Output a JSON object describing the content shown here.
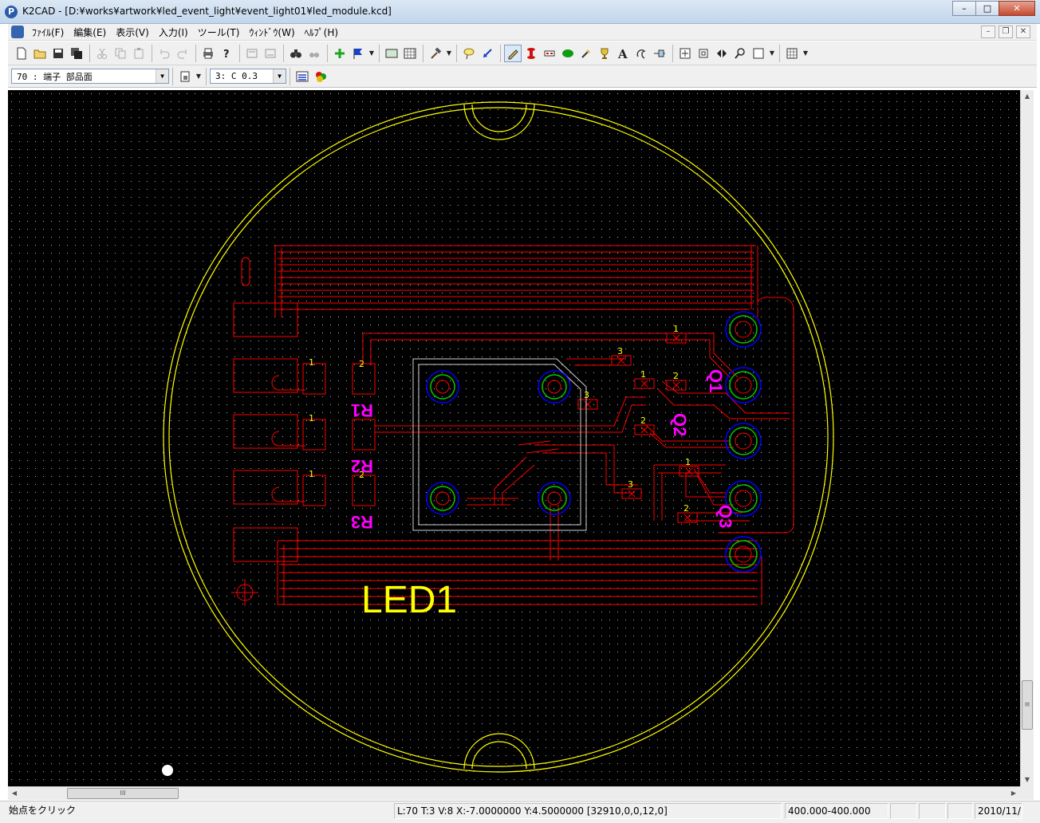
{
  "window": {
    "title": "K2CAD - [D:¥works¥artwork¥led_event_light¥event_light01¥led_module.kcd]",
    "app_icon_glyph": "P",
    "minimize": "–",
    "maximize": "□",
    "close": "✕"
  },
  "menu": {
    "items": [
      "ﾌｧｲﾙ(F)",
      "編集(E)",
      "表示(V)",
      "入力(I)",
      "ツール(T)",
      "ｳｨﾝﾄﾞｳ(W)",
      "ﾍﾙﾌﾟ(H)"
    ],
    "mdi_minimize": "–",
    "mdi_restore": "❐",
    "mdi_close": "✕"
  },
  "toolbar2": {
    "layer_select": "70 : 端子  部品面",
    "line_select": "3: C 0.3"
  },
  "canvas": {
    "label_led": "LED1",
    "label_q1": "Q1",
    "label_q2": "Q2",
    "label_q3": "Q3",
    "label_r1": "R1",
    "label_r2": "R2",
    "label_r3": "R3"
  },
  "scroll": {
    "h_thumb_grip": "III",
    "v_thumb_grip": "≡"
  },
  "status": {
    "message": "始点をクリック",
    "coords": "L:70 T:3 V:8 X:-7.0000000 Y:4.5000000 [32910,0,0,12,0]",
    "range": "400.000-400.000",
    "date": "2010/11/"
  },
  "colors": {
    "canvas_bg": "#000000",
    "outline": "#ffff00",
    "trace": "#ff0000",
    "pad_blue": "#0000ff",
    "pad_green": "#00cc00",
    "silk_text": "#ff00ff",
    "frame": "#d0d0d0"
  }
}
